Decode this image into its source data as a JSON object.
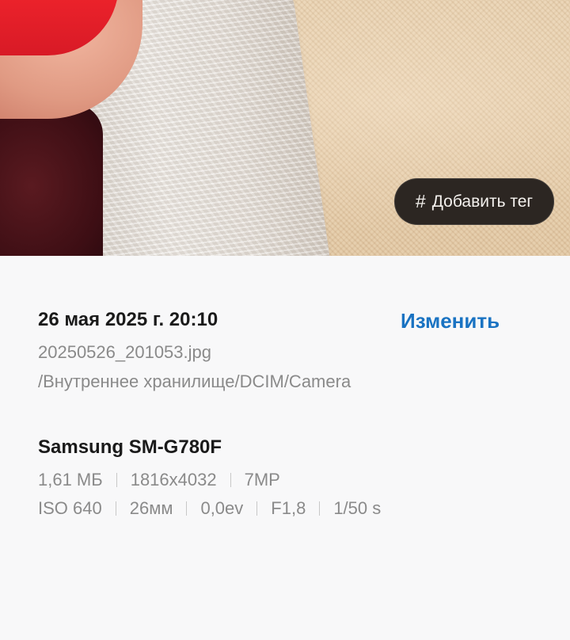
{
  "photo": {
    "tag_button": {
      "icon": "hash-icon",
      "label": "Добавить тег"
    }
  },
  "details": {
    "datetime": "26 мая 2025 г. 20:10",
    "edit_label": "Изменить",
    "filename": "20250526_201053.jpg",
    "path": "/Внутреннее хранилище/DCIM/Camera",
    "device": "Samsung SM-G780F",
    "file_info": [
      "1,61 МБ",
      "1816x4032",
      "7MP"
    ],
    "camera_info": [
      "ISO 640",
      "26мм",
      "0,0ev",
      "F1,8",
      "1/50 s"
    ]
  },
  "colors": {
    "accent": "#1a73c2",
    "pill_bg": "#2c2622",
    "secondary_text": "#8a8a8a",
    "background": "#f8f8f9"
  }
}
